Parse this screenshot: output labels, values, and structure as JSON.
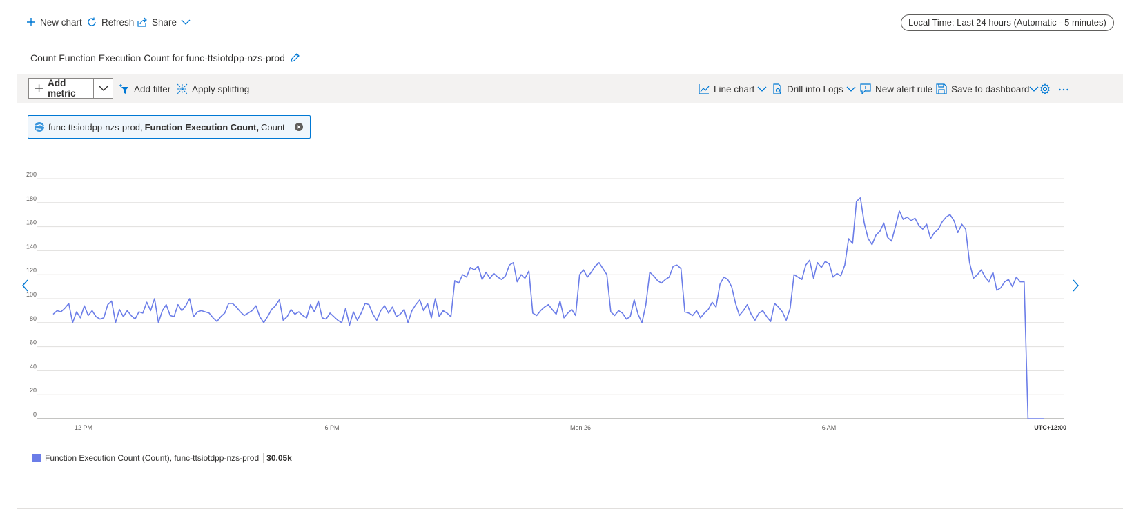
{
  "toolbar": {
    "new_chart": "New chart",
    "refresh": "Refresh",
    "share": "Share",
    "time_range": "Local Time: Last 24 hours (Automatic - 5 minutes)"
  },
  "chart_card": {
    "title": "Count Function Execution Count for func-ttsiotdpp-nzs-prod",
    "actions": {
      "add_metric": "Add metric",
      "add_filter": "Add filter",
      "apply_splitting": "Apply splitting",
      "line_chart": "Line chart",
      "drill_into_logs": "Drill into Logs",
      "new_alert_rule": "New alert rule",
      "save_to_dashboard": "Save to dashboard"
    },
    "metric_pill": {
      "resource": "func-ttsiotdpp-nzs-prod,",
      "metric": "Function Execution Count,",
      "aggregation": "Count"
    },
    "legend": {
      "label": "Function Execution Count (Count), func-ttsiotdpp-nzs-prod",
      "value": "30.05k"
    }
  },
  "colors": {
    "series": "#6b7de8",
    "accent": "#0078d4",
    "grid": "#e1dfdd"
  },
  "chart_data": {
    "type": "line",
    "title": "",
    "xlabel": "",
    "ylabel": "",
    "ylim": [
      0,
      200
    ],
    "y_ticks": [
      0,
      20,
      40,
      60,
      80,
      100,
      120,
      140,
      160,
      180,
      200
    ],
    "x_ticks": [
      "12 PM",
      "6 PM",
      "Mon 26",
      "6 AM"
    ],
    "timezone_label": "UTC+12:00",
    "grid": true,
    "legend_position": "bottom-left",
    "series": [
      {
        "name": "Function Execution Count (Count), func-ttsiotdpp-nzs-prod",
        "values": [
          87,
          90,
          89,
          92,
          96,
          80,
          89,
          84,
          94,
          86,
          90,
          85,
          83,
          84,
          95,
          98,
          80,
          91,
          85,
          90,
          86,
          83,
          89,
          88,
          97,
          90,
          100,
          80,
          90,
          95,
          86,
          85,
          95,
          90,
          94,
          100,
          85,
          89,
          90,
          89,
          88,
          84,
          81,
          85,
          88,
          96,
          96,
          93,
          89,
          86,
          88,
          90,
          94,
          85,
          80,
          85,
          91,
          94,
          99,
          82,
          85,
          91,
          87,
          89,
          86,
          84,
          95,
          89,
          98,
          84,
          83,
          88,
          85,
          82,
          80,
          92,
          78,
          89,
          82,
          88,
          96,
          95,
          87,
          82,
          90,
          94,
          88,
          93,
          85,
          87,
          91,
          80,
          90,
          95,
          99,
          90,
          96,
          84,
          100,
          85,
          90,
          88,
          85,
          115,
          113,
          120,
          118,
          126,
          124,
          127,
          116,
          122,
          117,
          121,
          118,
          116,
          119,
          128,
          130,
          114,
          120,
          117,
          123,
          88,
          86,
          90,
          93,
          95,
          91,
          87,
          98,
          84,
          88,
          91,
          86,
          120,
          124,
          118,
          122,
          127,
          130,
          125,
          120,
          89,
          86,
          90,
          88,
          83,
          85,
          99,
          87,
          80,
          95,
          122,
          119,
          115,
          113,
          116,
          118,
          127,
          128,
          125,
          89,
          88,
          86,
          90,
          84,
          88,
          91,
          97,
          93,
          112,
          118,
          116,
          110,
          96,
          86,
          90,
          95,
          87,
          82,
          88,
          90,
          85,
          81,
          96,
          93,
          89,
          82,
          92,
          120,
          118,
          116,
          128,
          132,
          117,
          130,
          126,
          131,
          129,
          118,
          121,
          119,
          128,
          150,
          146,
          181,
          184,
          163,
          150,
          145,
          153,
          156,
          163,
          151,
          148,
          160,
          173,
          166,
          168,
          165,
          167,
          161,
          158,
          162,
          150,
          155,
          158,
          164,
          168,
          170,
          165,
          155,
          162,
          158,
          130,
          117,
          120,
          124,
          118,
          114,
          122,
          107,
          109,
          114,
          116,
          110,
          118,
          114,
          114,
          0,
          0,
          0,
          0,
          0
        ]
      }
    ]
  }
}
